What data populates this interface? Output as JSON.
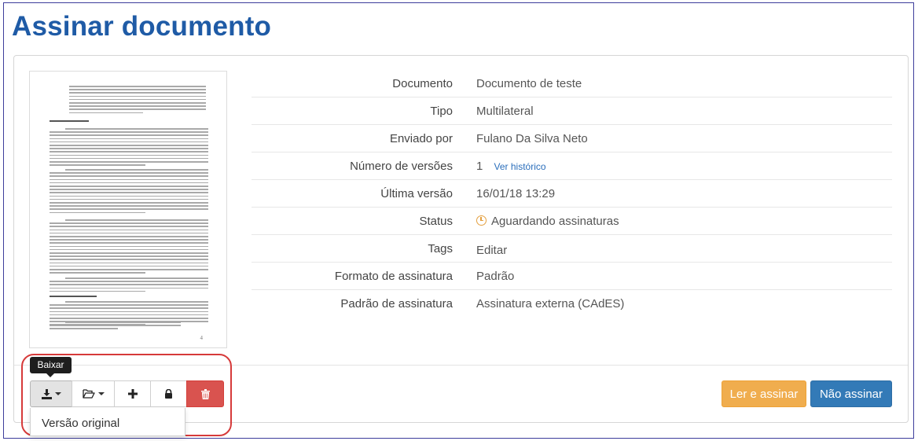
{
  "page": {
    "title": "Assinar documento"
  },
  "details": [
    {
      "label": "Documento",
      "value": "Documento de teste"
    },
    {
      "label": "Tipo",
      "value": "Multilateral"
    },
    {
      "label": "Enviado por",
      "value": "Fulano Da Silva Neto"
    },
    {
      "label": "Número de versões",
      "value": "1",
      "link": "Ver histórico"
    },
    {
      "label": "Última versão",
      "value": "16/01/18 13:29"
    },
    {
      "label": "Status",
      "value": "Aguardando assinaturas",
      "icon": "clock-icon"
    },
    {
      "label": "Tags",
      "link": "Editar"
    },
    {
      "label": "Formato de assinatura",
      "value": "Padrão"
    },
    {
      "label": "Padrão de assinatura",
      "value": "Assinatura externa (CAdES)"
    }
  ],
  "toolbar": {
    "tooltip": "Baixar",
    "buttons": [
      {
        "icon": "download-icon",
        "has_caret": true,
        "active": true
      },
      {
        "icon": "folder-open-icon",
        "has_caret": true
      },
      {
        "icon": "plus-icon"
      },
      {
        "icon": "lock-icon"
      },
      {
        "icon": "trash-icon",
        "style": "danger"
      }
    ],
    "dropdown_items": [
      "Versão original"
    ]
  },
  "actions": {
    "read_and_sign": "Ler e assinar",
    "decline": "Não assinar"
  },
  "thumbnail": {
    "page_number": "4"
  },
  "colors": {
    "title": "#1f5ba6",
    "status": "#e4a040",
    "warning": "#f0ad4e",
    "primary": "#337ab7",
    "danger": "#d9534f",
    "highlight_outline": "#d63a3a"
  }
}
